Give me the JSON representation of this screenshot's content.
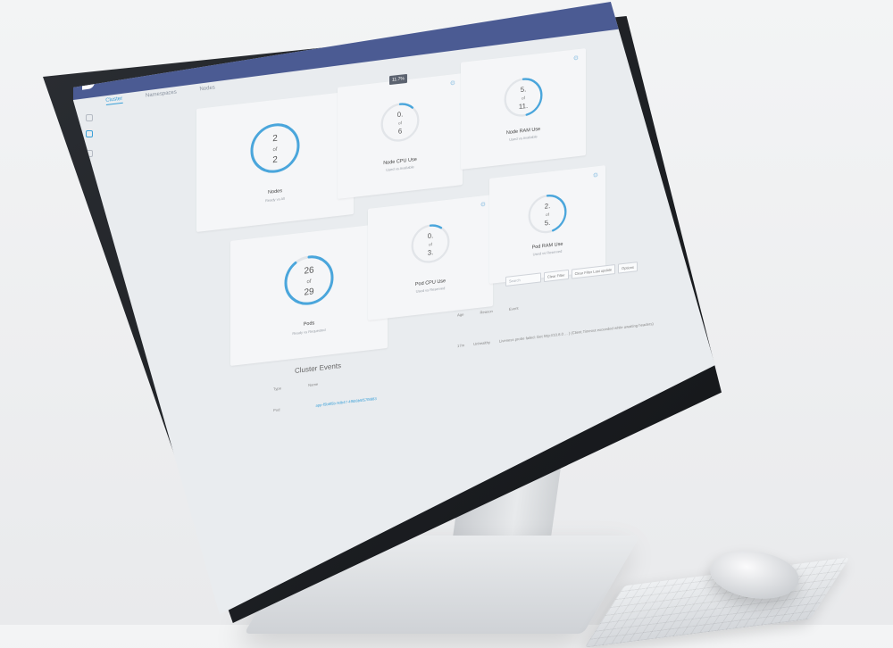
{
  "app": {
    "title": "Cluster"
  },
  "tabs": [
    {
      "label": "Cluster",
      "active": true
    },
    {
      "label": "Namespaces",
      "active": false
    },
    {
      "label": "Nodes",
      "active": false
    }
  ],
  "sidebar_icons": [
    "home-icon",
    "cluster-icon",
    "box-icon",
    "storage-icon",
    "user-icon",
    "network-icon",
    "heart-icon",
    "settings-icon",
    "flag-icon",
    "help-icon"
  ],
  "cards": {
    "nodes": {
      "value": "2",
      "of": "of",
      "total": "2",
      "label": "Nodes",
      "sublabel": "Ready vs All",
      "fraction": 1.0
    },
    "pods": {
      "value": "26",
      "of": "of",
      "total": "29",
      "label": "Pods",
      "sublabel": "Ready vs Requested",
      "fraction": 0.9
    },
    "node_cpu": {
      "value": "0.",
      "of": "of",
      "total": "6",
      "label": "Node CPU Use",
      "sublabel": "Used vs Available",
      "tooltip": "11.7%",
      "fraction": 0.12
    },
    "pod_cpu": {
      "value": "0.",
      "of": "of",
      "total": "3.",
      "label": "Pod CPU Use",
      "sublabel": "Used vs Reserved",
      "fraction": 0.1
    },
    "node_ram": {
      "value": "5.",
      "of": "of",
      "total": "11.",
      "label": "Node RAM Use",
      "sublabel": "Used vs Available",
      "fraction": 0.47
    },
    "pod_ram": {
      "value": "2.",
      "of": "of",
      "total": "5.",
      "label": "Pod RAM Use",
      "sublabel": "Used vs Reserved",
      "fraction": 0.45
    }
  },
  "events": {
    "title": "Cluster Events",
    "toolbar": {
      "search_placeholder": "Search",
      "clear_filter": "Clear Filter",
      "clear_all": "Clear Filter Last update",
      "options": "Options"
    },
    "columns": [
      "Type",
      "Name",
      "Age",
      "Reason",
      "Event"
    ],
    "rows": [
      {
        "type": "Pod",
        "name": "app-f5b8f5b-9db47-4f5b8b5f57f8883",
        "age": "17m",
        "reason": "Unhealthy",
        "event": "Liveness probe failed: Get http://10.8.0 ... ) (Client.Timeout exceeded while awaiting headers)"
      }
    ]
  },
  "colors": {
    "topbar": "#4b5b93",
    "accent": "#3aa0d8",
    "card_bg": "#f5f6f8"
  }
}
